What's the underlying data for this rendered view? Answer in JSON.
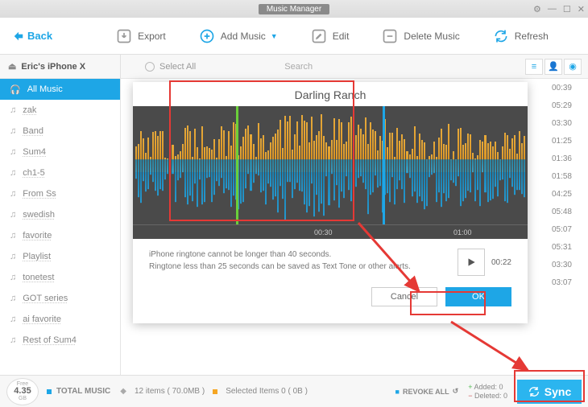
{
  "titlebar": {
    "title": "Music Manager"
  },
  "toolbar": {
    "back": "Back",
    "export": "Export",
    "add_music": "Add Music",
    "edit": "Edit",
    "delete": "Delete Music",
    "refresh": "Refresh"
  },
  "subbar": {
    "device": "Eric's iPhone X",
    "select_all": "Select All",
    "search_placeholder": "Search"
  },
  "sidebar": {
    "items": [
      {
        "label": "All Music"
      },
      {
        "label": "zak"
      },
      {
        "label": "Band"
      },
      {
        "label": "Sum4"
      },
      {
        "label": "ch1-5"
      },
      {
        "label": "From Ss"
      },
      {
        "label": "swedish"
      },
      {
        "label": "favorite"
      },
      {
        "label": "Playlist"
      },
      {
        "label": "tonetest"
      },
      {
        "label": "GOT series"
      },
      {
        "label": "ai favorite"
      },
      {
        "label": "Rest of Sum4"
      }
    ]
  },
  "durations": [
    "00:39",
    "05:29",
    "03:30",
    "01:25",
    "01:36",
    "01:58",
    "04:25",
    "05:48",
    "05:07",
    "05:31",
    "03:30",
    "03:07"
  ],
  "modal": {
    "title": "Darling Ranch",
    "time1": "00:30",
    "time2": "01:00",
    "info1": "iPhone ringtone cannot be longer than 40 seconds.",
    "info2": "Ringtone less than 25 seconds can be saved as Text Tone or other alerts.",
    "play_time": "00:22",
    "cancel": "Cancel",
    "ok": "OK"
  },
  "footer": {
    "free_label": "Free",
    "free_size": "4.35",
    "free_unit": "GB",
    "total_label": "TOTAL MUSIC",
    "total_detail": "12 items ( 70.0MB )",
    "selected_label": "Selected Items 0 ( 0B )",
    "revoke": "REVOKE ALL",
    "added": "Added: 0",
    "deleted": "Deleted: 0",
    "sync": "Sync"
  }
}
